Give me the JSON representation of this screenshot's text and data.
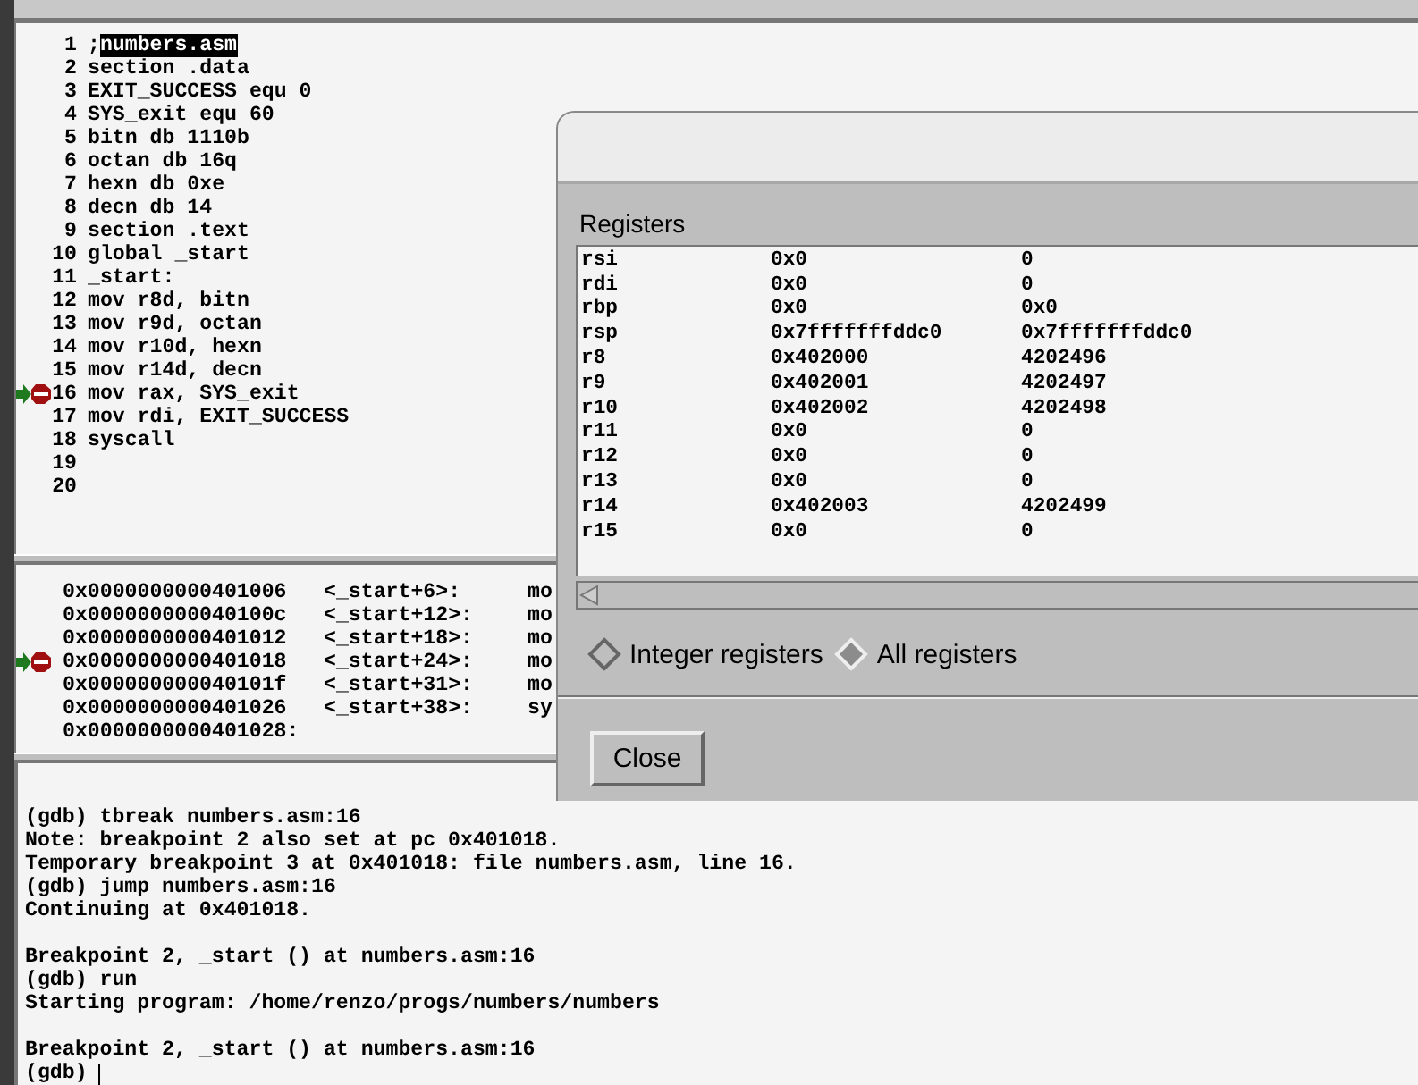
{
  "source": {
    "lines": [
      {
        "number": "1",
        "text": ";",
        "selected_text": "numbers.asm",
        "breakpoint": false,
        "current": false
      },
      {
        "number": "2",
        "text": "section .data",
        "breakpoint": false,
        "current": false
      },
      {
        "number": "3",
        "text": "EXIT_SUCCESS equ 0",
        "breakpoint": false,
        "current": false
      },
      {
        "number": "4",
        "text": "SYS_exit equ 60",
        "breakpoint": false,
        "current": false
      },
      {
        "number": "5",
        "text": "bitn db 1110b",
        "breakpoint": false,
        "current": false
      },
      {
        "number": "6",
        "text": "octan db 16q",
        "breakpoint": false,
        "current": false
      },
      {
        "number": "7",
        "text": "hexn db 0xe",
        "breakpoint": false,
        "current": false
      },
      {
        "number": "8",
        "text": "decn db 14",
        "breakpoint": false,
        "current": false
      },
      {
        "number": "9",
        "text": "section .text",
        "breakpoint": false,
        "current": false
      },
      {
        "number": "10",
        "text": "global _start",
        "breakpoint": false,
        "current": false
      },
      {
        "number": "11",
        "text": "_start:",
        "breakpoint": false,
        "current": false
      },
      {
        "number": "12",
        "text": "mov r8d, bitn",
        "breakpoint": false,
        "current": false
      },
      {
        "number": "13",
        "text": "mov r9d, octan",
        "breakpoint": false,
        "current": false
      },
      {
        "number": "14",
        "text": "mov r10d, hexn",
        "breakpoint": false,
        "current": false
      },
      {
        "number": "15",
        "text": "mov r14d, decn",
        "breakpoint": false,
        "current": false
      },
      {
        "number": "16",
        "text": "mov rax, SYS_exit",
        "breakpoint": true,
        "current": true
      },
      {
        "number": "17",
        "text": "mov rdi, EXIT_SUCCESS",
        "breakpoint": false,
        "current": false
      },
      {
        "number": "18",
        "text": "syscall",
        "breakpoint": false,
        "current": false
      },
      {
        "number": "19",
        "breakpoint": false,
        "current": false
      },
      {
        "number": "20",
        "breakpoint": false,
        "current": false
      }
    ]
  },
  "disassembly": {
    "rows": [
      {
        "address": "0x0000000000401006",
        "offset": "<_start+6>:",
        "instruction": "mo",
        "breakpoint": false,
        "current": false
      },
      {
        "address": "0x000000000040100c",
        "offset": "<_start+12>:",
        "instruction": "mo",
        "breakpoint": false,
        "current": false
      },
      {
        "address": "0x0000000000401012",
        "offset": "<_start+18>:",
        "instruction": "mo",
        "breakpoint": false,
        "current": false
      },
      {
        "address": "0x0000000000401018",
        "offset": "<_start+24>:",
        "instruction": "mo",
        "breakpoint": true,
        "current": true
      },
      {
        "address": "0x000000000040101f",
        "offset": "<_start+31>:",
        "instruction": "mo",
        "breakpoint": false,
        "current": false
      },
      {
        "address": "0x0000000000401026",
        "offset": "<_start+38>:",
        "instruction": "sy",
        "breakpoint": false,
        "current": false
      },
      {
        "address": "0x0000000000401028:",
        "offset": "",
        "instruction": "",
        "breakpoint": false,
        "current": false
      }
    ]
  },
  "console": {
    "lines": [
      {
        "kind": "output",
        "text": "(gdb) tbreak numbers.asm:16"
      },
      {
        "kind": "output",
        "text": "Note: breakpoint 2 also set at pc 0x401018."
      },
      {
        "kind": "output",
        "text": "Temporary breakpoint 3 at 0x401018: file numbers.asm, line 16."
      },
      {
        "kind": "output",
        "text": "(gdb) jump numbers.asm:16"
      },
      {
        "kind": "output",
        "text": "Continuing at 0x401018."
      },
      {
        "kind": "blank"
      },
      {
        "kind": "output",
        "text": "Breakpoint 2, _start () at numbers.asm:16"
      },
      {
        "kind": "output",
        "text": "(gdb) run"
      },
      {
        "kind": "output",
        "text": "Starting program: /home/renzo/progs/numbers/numbers"
      },
      {
        "kind": "blank"
      },
      {
        "kind": "output",
        "text": "Breakpoint 2, _start () at numbers.asm:16"
      }
    ],
    "prompt": "(gdb)"
  },
  "registers_dialog": {
    "label": "Registers",
    "rows": [
      {
        "name": "rsi",
        "hex": "0x0",
        "natural": "0"
      },
      {
        "name": "rdi",
        "hex": "0x0",
        "natural": "0"
      },
      {
        "name": "rbp",
        "hex": "0x0",
        "natural": "0x0"
      },
      {
        "name": "rsp",
        "hex": "0x7fffffffddc0",
        "natural": "0x7fffffffddc0"
      },
      {
        "name": "r8",
        "hex": "0x402000",
        "natural": "4202496"
      },
      {
        "name": "r9",
        "hex": "0x402001",
        "natural": "4202497"
      },
      {
        "name": "r10",
        "hex": "0x402002",
        "natural": "4202498"
      },
      {
        "name": "r11",
        "hex": "0x0",
        "natural": "0"
      },
      {
        "name": "r12",
        "hex": "0x0",
        "natural": "0"
      },
      {
        "name": "r13",
        "hex": "0x0",
        "natural": "0"
      },
      {
        "name": "r14",
        "hex": "0x402003",
        "natural": "4202499"
      },
      {
        "name": "r15",
        "hex": "0x0",
        "natural": "0"
      }
    ],
    "options": [
      {
        "label": "Integer registers",
        "selected": false
      },
      {
        "label": "All registers",
        "selected": true
      }
    ],
    "close_button": "Close"
  }
}
